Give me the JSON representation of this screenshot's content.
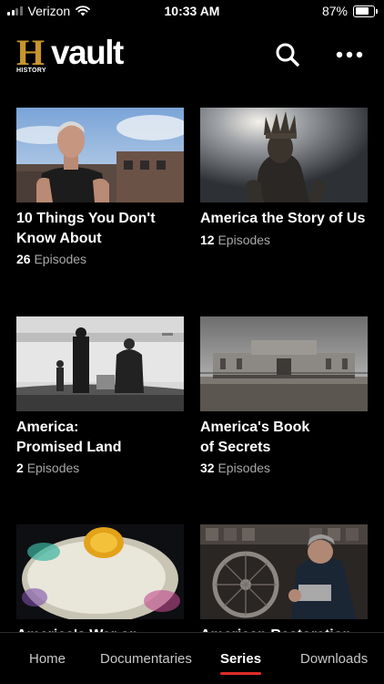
{
  "status_bar": {
    "carrier": "Verizon",
    "time": "10:33 AM",
    "battery": "87%",
    "battery_level": 0.87,
    "signal_bars": 2,
    "wifi_icon": "wifi-icon"
  },
  "header": {
    "logo_letter": "H",
    "logo_brand": "HISTORY",
    "logo_product": "vault",
    "logo_color": "#c8952c",
    "search_icon": "search-icon",
    "more_icon": "more-icon"
  },
  "series": [
    {
      "title": "10 Things You Don't\nKnow About",
      "count": "26",
      "unit": "Episodes"
    },
    {
      "title": "America the Story of Us",
      "count": "12",
      "unit": "Episodes"
    },
    {
      "title": "America:\nPromised Land",
      "count": "2",
      "unit": "Episodes"
    },
    {
      "title": "America's Book\nof Secrets",
      "count": "32",
      "unit": "Episodes"
    },
    {
      "title": "America's War on Drugs",
      "count": "",
      "unit": ""
    },
    {
      "title": "American Restoration",
      "count": "",
      "unit": ""
    }
  ],
  "tabs": [
    {
      "label": "Home",
      "active": false
    },
    {
      "label": "Documentaries",
      "active": false
    },
    {
      "label": "Series",
      "active": true
    },
    {
      "label": "Downloads",
      "active": false
    }
  ],
  "colors": {
    "accent": "#e22b26",
    "muted_text": "#a8a8a8"
  }
}
